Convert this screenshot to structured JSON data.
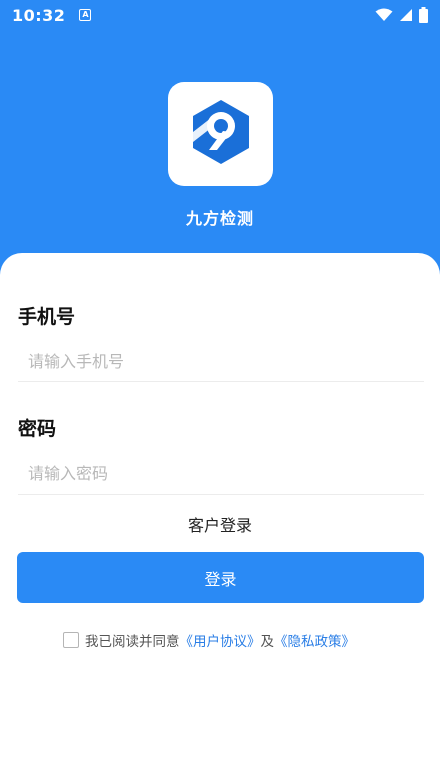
{
  "status_bar": {
    "time": "10:32",
    "app_icon_glyph": "A",
    "icons": [
      "wifi-icon",
      "signal-icon",
      "battery-icon"
    ]
  },
  "app": {
    "name": "九方检测",
    "logo_icon": "hexagon-nine-logo-icon"
  },
  "form": {
    "phone_label": "手机号",
    "phone_placeholder": "请输入手机号",
    "phone_value": "",
    "password_label": "密码",
    "password_placeholder": "请输入密码",
    "password_value": "",
    "customer_login": "客户登录",
    "login_button": "登录"
  },
  "agreement": {
    "checked": false,
    "prefix": "我已阅读并同意",
    "user_agreement": "《用户协议》",
    "conjunction": "及",
    "privacy_policy": "《隐私政策》"
  },
  "colors": {
    "primary": "#2a8af5",
    "link": "#2a7ee6",
    "placeholder": "#b8b8b8"
  }
}
